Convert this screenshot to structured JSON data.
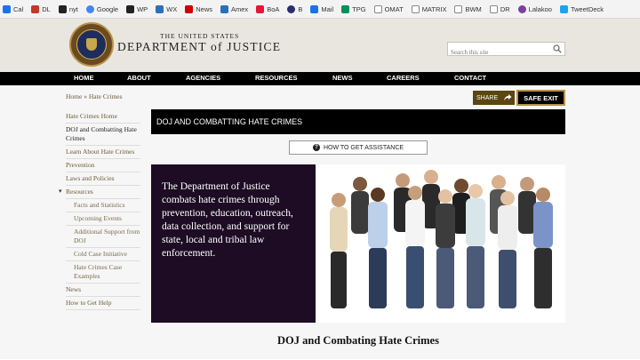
{
  "bookmarks": [
    {
      "label": "Cal",
      "color": "#1a73e8"
    },
    {
      "label": "DL",
      "color": "#c0392b"
    },
    {
      "label": "nyt",
      "color": "#222222"
    },
    {
      "label": "Google",
      "color": "#4285f4"
    },
    {
      "label": "WP",
      "color": "#222222"
    },
    {
      "label": "WX",
      "color": "#2c6fbb"
    },
    {
      "label": "News",
      "color": "#cc0000"
    },
    {
      "label": "Amex",
      "color": "#2671b9"
    },
    {
      "label": "BoA",
      "color": "#e31837"
    },
    {
      "label": "B",
      "color": "#2b2b6e"
    },
    {
      "label": "Mail",
      "color": "#1a73e8"
    },
    {
      "label": "TPG",
      "color": "#0a8f5a"
    },
    {
      "label": "OMAT",
      "color": "#555555"
    },
    {
      "label": "MATRIX",
      "color": "#888888"
    },
    {
      "label": "BWM",
      "color": "#666666"
    },
    {
      "label": "DR",
      "color": "#444444"
    },
    {
      "label": "Lalakoo",
      "color": "#7b3fa0"
    },
    {
      "label": "TweetDeck",
      "color": "#1da1f2"
    }
  ],
  "header": {
    "small_title": "THE UNITED STATES",
    "big_title": "DEPARTMENT of JUSTICE",
    "search_placeholder": "Search this site"
  },
  "nav": [
    "HOME",
    "ABOUT",
    "AGENCIES",
    "RESOURCES",
    "NEWS",
    "CAREERS",
    "CONTACT"
  ],
  "breadcrumb": "Home » Hate Crimes",
  "sidebar": {
    "items": [
      {
        "label": "Hate Crimes Home"
      },
      {
        "label": "DOJ and Combatting Hate Crimes"
      },
      {
        "label": "Learn About Hate Crimes"
      },
      {
        "label": "Prevention"
      },
      {
        "label": "Laws and Policies"
      },
      {
        "label": "Resources"
      },
      {
        "label": "Facts and Statistics"
      },
      {
        "label": "Upcoming Events"
      },
      {
        "label": "Additional Support from DOJ"
      },
      {
        "label": "Cold Case Initiative"
      },
      {
        "label": "Hate Crimes Case Examples"
      },
      {
        "label": "News"
      },
      {
        "label": "How to Get Help"
      }
    ]
  },
  "actions": {
    "share_label": "SHARE",
    "safe_exit_label": "SAFE EXIT"
  },
  "main": {
    "title": "DOJ AND COMBATTING HATE CRIMES",
    "assist_label": "HOW TO GET ASSISTANCE",
    "mission": "The Department of Justice combats hate crimes through prevention, education, outreach, data collection, and support for state, local and tribal law enforcement.",
    "section_heading": "DOJ and Combating Hate Crimes"
  },
  "colors": {
    "nav_bg": "#000000",
    "mission_bg": "#1d0c24",
    "accent_gold": "#b89248",
    "share_bg": "#5b4612"
  }
}
